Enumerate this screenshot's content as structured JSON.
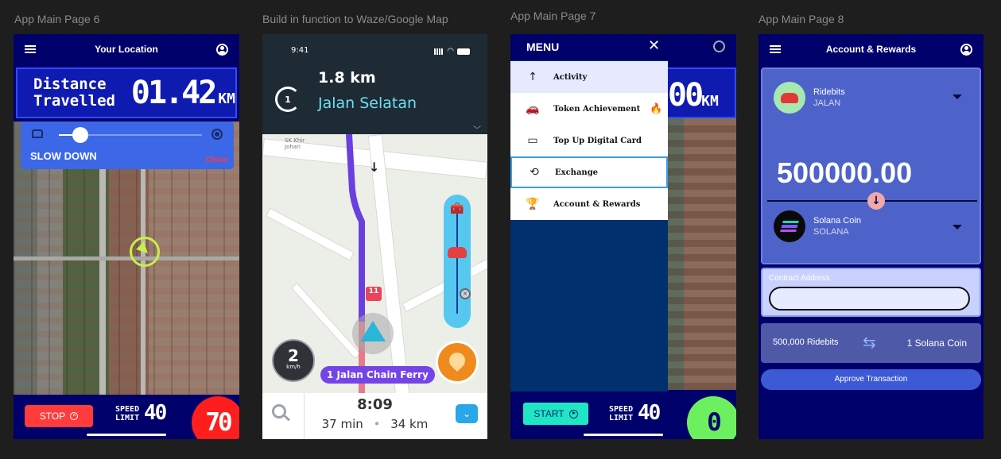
{
  "frames": {
    "f1": "App Main Page 6",
    "f2": "Build in function to Waze/Google Map",
    "f3": "App Main Page 7",
    "f4": "App Main Page 8"
  },
  "page6": {
    "title": "Your Location",
    "distance_label_line1": "Distance",
    "distance_label_line2": "Travelled",
    "distance_value": "01.42",
    "distance_unit": "KM",
    "speed_slider_value": 0.15,
    "alert_text": "SLOW DOWN",
    "close_label": "Close",
    "stop_label": "STOP",
    "speed_limit_line1": "SPEED",
    "speed_limit_line2": "LIMIT",
    "speed_limit_value": "40",
    "current_speed": "70",
    "current_speed_color": "#ff1e1e"
  },
  "googlemap": {
    "status_time": "9:41",
    "turn_count": "1",
    "next_distance": "1.8 km",
    "next_street": "Jalan Selatan",
    "place_label_1": "SK Khir",
    "place_label_2": "Johari",
    "route_badge": "11",
    "speed_value": "2",
    "speed_unit": "km/h",
    "current_street": "1 Jalan Chain Ferry",
    "eta": "8:09",
    "duration": "37 min",
    "distance": "34 km"
  },
  "page7": {
    "menu_title": "MENU",
    "close_glyph": "✕",
    "items": [
      {
        "label": "Activity",
        "icon": "↑"
      },
      {
        "label": "Token Achievement",
        "icon": "🚗"
      },
      {
        "label": "Top Up Digital Card",
        "icon": "▭"
      },
      {
        "label": "Exchange",
        "icon": "⟲"
      },
      {
        "label": "Account & Rewards",
        "icon": "🏆"
      }
    ],
    "background_digits": "00",
    "background_unit": "KM",
    "start_label": "START",
    "speed_limit_line1": "SPEED",
    "speed_limit_line2": "LIMIT",
    "speed_limit_value": "40",
    "current_speed": "0",
    "current_speed_color": "#6df060"
  },
  "page8": {
    "title": "Account & Rewards",
    "from_coin_name": "Ridebits",
    "from_coin_symbol": "JALAN",
    "amount": "500000.00",
    "to_coin_name": "Solana Coin",
    "to_coin_symbol": "SOLANA",
    "contract_label": "Contract Address",
    "contract_value": "",
    "rate_from": "500,000 Ridebits",
    "rate_to": "1 Solana Coin",
    "approve_label": "Approve Transaction"
  }
}
